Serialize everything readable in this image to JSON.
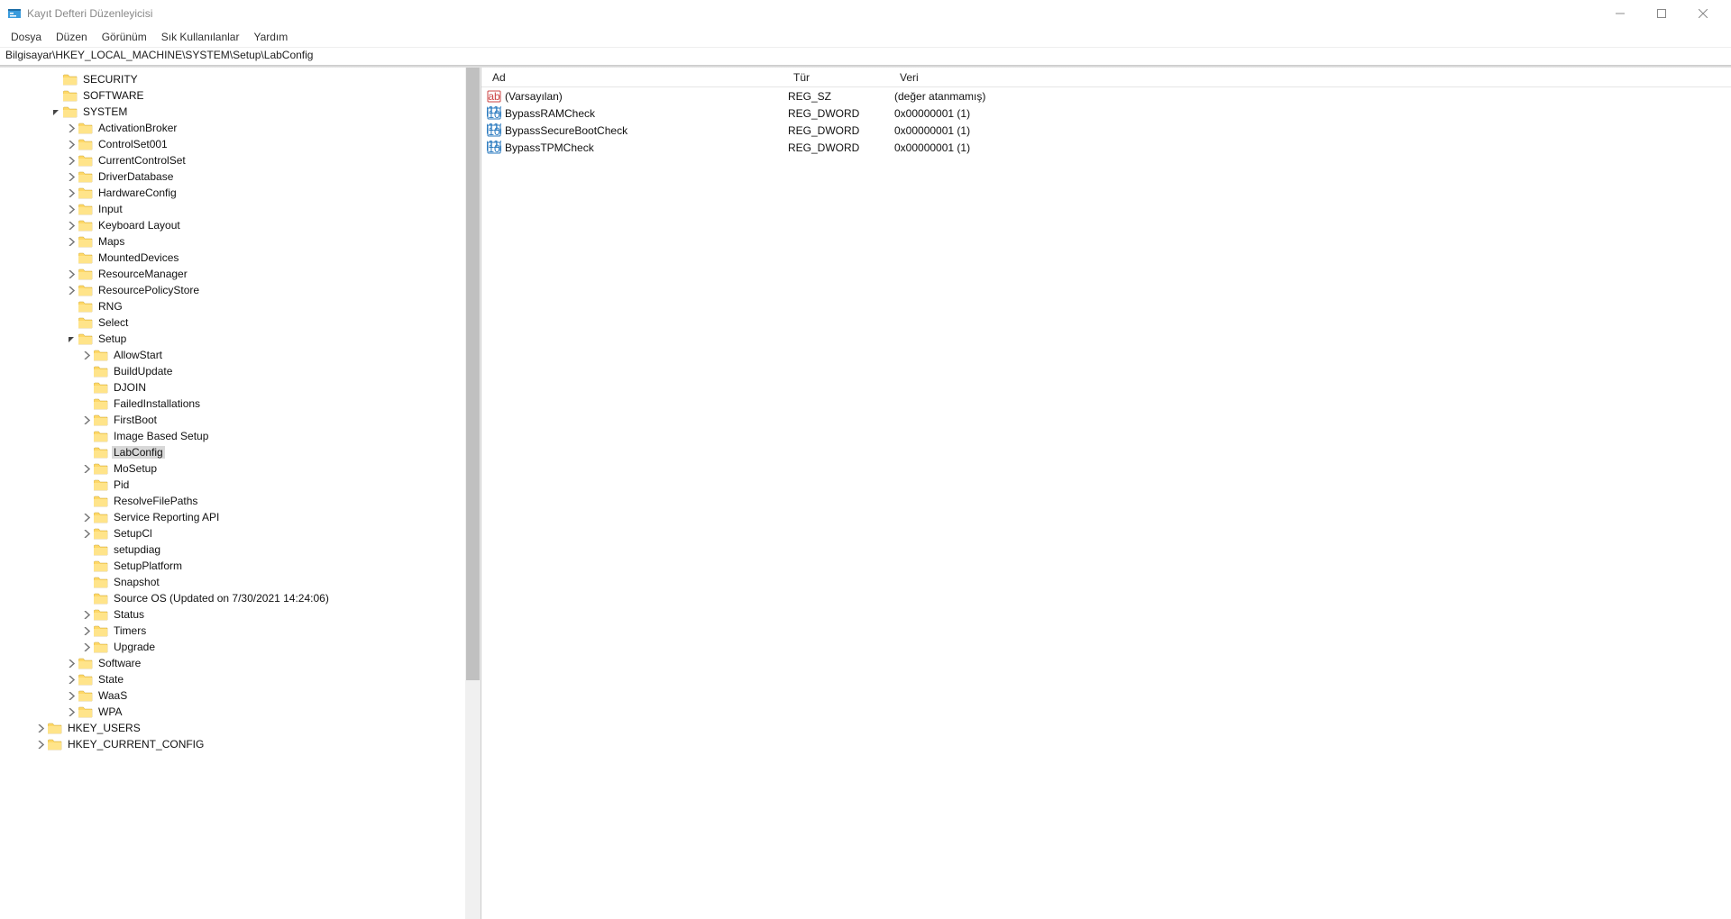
{
  "window": {
    "title": "Kayıt Defteri Düzenleyicisi"
  },
  "menu": {
    "items": [
      "Dosya",
      "Düzen",
      "Görünüm",
      "Sık Kullanılanlar",
      "Yardım"
    ]
  },
  "address": "Bilgisayar\\HKEY_LOCAL_MACHINE\\SYSTEM\\Setup\\LabConfig",
  "columns": {
    "name": "Ad",
    "type": "Tür",
    "data": "Veri"
  },
  "values": [
    {
      "icon": "string",
      "name": "(Varsayılan)",
      "type": "REG_SZ",
      "data": "(değer atanmamış)"
    },
    {
      "icon": "dword",
      "name": "BypassRAMCheck",
      "type": "REG_DWORD",
      "data": "0x00000001 (1)"
    },
    {
      "icon": "dword",
      "name": "BypassSecureBootCheck",
      "type": "REG_DWORD",
      "data": "0x00000001 (1)"
    },
    {
      "icon": "dword",
      "name": "BypassTPMCheck",
      "type": "REG_DWORD",
      "data": "0x00000001 (1)"
    }
  ],
  "tree": [
    {
      "depth": 2,
      "exp": "none",
      "label": "SECURITY"
    },
    {
      "depth": 2,
      "exp": "none",
      "label": "SOFTWARE"
    },
    {
      "depth": 2,
      "exp": "open",
      "label": "SYSTEM"
    },
    {
      "depth": 3,
      "exp": "closed",
      "label": "ActivationBroker"
    },
    {
      "depth": 3,
      "exp": "closed",
      "label": "ControlSet001"
    },
    {
      "depth": 3,
      "exp": "closed",
      "label": "CurrentControlSet"
    },
    {
      "depth": 3,
      "exp": "closed",
      "label": "DriverDatabase"
    },
    {
      "depth": 3,
      "exp": "closed",
      "label": "HardwareConfig"
    },
    {
      "depth": 3,
      "exp": "closed",
      "label": "Input"
    },
    {
      "depth": 3,
      "exp": "closed",
      "label": "Keyboard Layout"
    },
    {
      "depth": 3,
      "exp": "closed",
      "label": "Maps"
    },
    {
      "depth": 3,
      "exp": "none",
      "label": "MountedDevices"
    },
    {
      "depth": 3,
      "exp": "closed",
      "label": "ResourceManager"
    },
    {
      "depth": 3,
      "exp": "closed",
      "label": "ResourcePolicyStore"
    },
    {
      "depth": 3,
      "exp": "none",
      "label": "RNG"
    },
    {
      "depth": 3,
      "exp": "none",
      "label": "Select"
    },
    {
      "depth": 3,
      "exp": "open",
      "label": "Setup"
    },
    {
      "depth": 4,
      "exp": "closed",
      "label": "AllowStart"
    },
    {
      "depth": 4,
      "exp": "none",
      "label": "BuildUpdate"
    },
    {
      "depth": 4,
      "exp": "none",
      "label": "DJOIN"
    },
    {
      "depth": 4,
      "exp": "none",
      "label": "FailedInstallations"
    },
    {
      "depth": 4,
      "exp": "closed",
      "label": "FirstBoot"
    },
    {
      "depth": 4,
      "exp": "none",
      "label": "Image Based Setup"
    },
    {
      "depth": 4,
      "exp": "none",
      "label": "LabConfig",
      "selected": true
    },
    {
      "depth": 4,
      "exp": "closed",
      "label": "MoSetup"
    },
    {
      "depth": 4,
      "exp": "none",
      "label": "Pid"
    },
    {
      "depth": 4,
      "exp": "none",
      "label": "ResolveFilePaths"
    },
    {
      "depth": 4,
      "exp": "closed",
      "label": "Service Reporting API"
    },
    {
      "depth": 4,
      "exp": "closed",
      "label": "SetupCl"
    },
    {
      "depth": 4,
      "exp": "none",
      "label": "setupdiag"
    },
    {
      "depth": 4,
      "exp": "none",
      "label": "SetupPlatform"
    },
    {
      "depth": 4,
      "exp": "none",
      "label": "Snapshot"
    },
    {
      "depth": 4,
      "exp": "none",
      "label": "Source OS (Updated on 7/30/2021 14:24:06)"
    },
    {
      "depth": 4,
      "exp": "closed",
      "label": "Status"
    },
    {
      "depth": 4,
      "exp": "closed",
      "label": "Timers"
    },
    {
      "depth": 4,
      "exp": "closed",
      "label": "Upgrade"
    },
    {
      "depth": 3,
      "exp": "closed",
      "label": "Software"
    },
    {
      "depth": 3,
      "exp": "closed",
      "label": "State"
    },
    {
      "depth": 3,
      "exp": "closed",
      "label": "WaaS"
    },
    {
      "depth": 3,
      "exp": "closed",
      "label": "WPA"
    },
    {
      "depth": 1,
      "exp": "closed",
      "label": "HKEY_USERS"
    },
    {
      "depth": 1,
      "exp": "closed",
      "label": "HKEY_CURRENT_CONFIG"
    }
  ]
}
